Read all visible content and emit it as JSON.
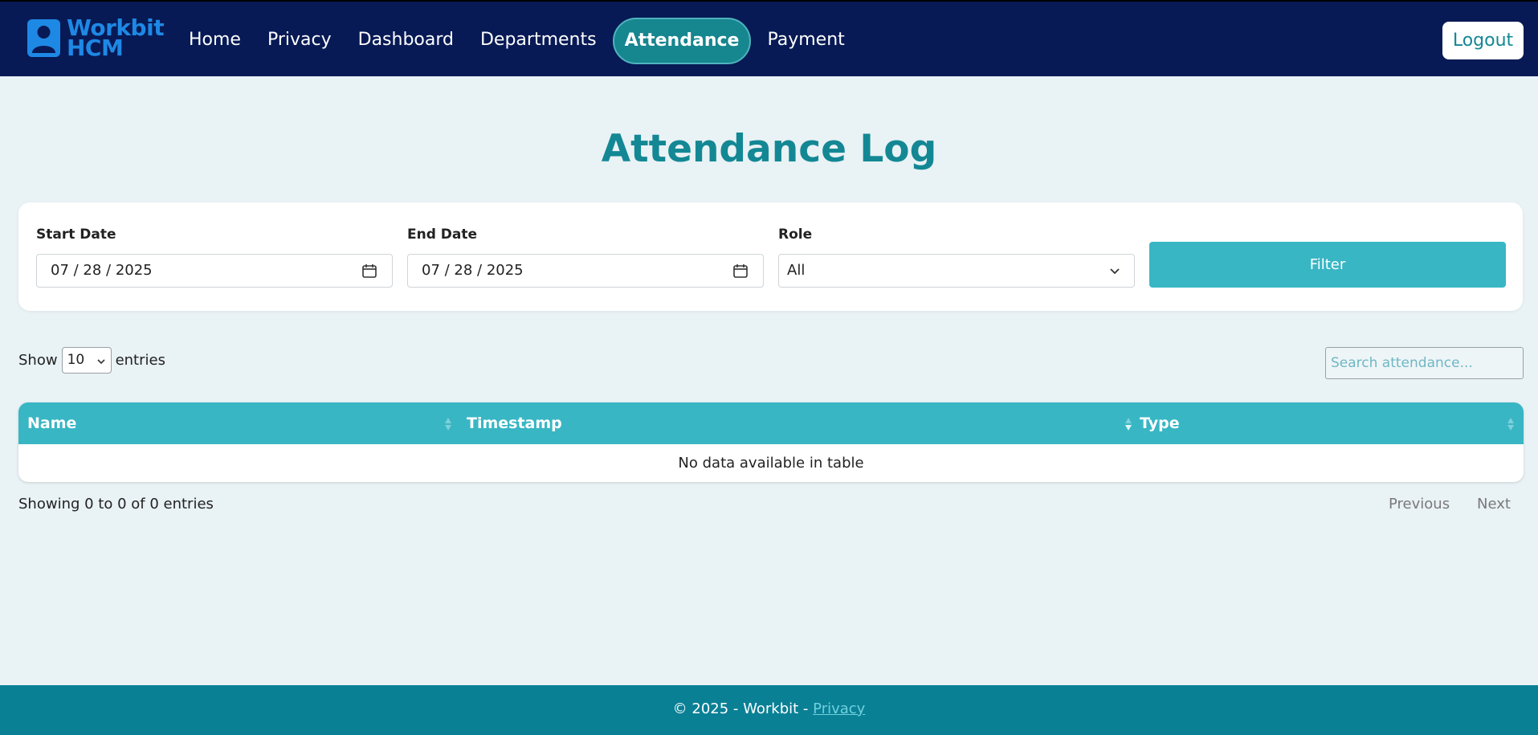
{
  "nav": {
    "brand_line1": "Workbit",
    "brand_line2": "HCM",
    "links": [
      "Home",
      "Privacy",
      "Dashboard",
      "Departments",
      "Attendance",
      "Payment"
    ],
    "active": "Attendance",
    "logout_label": "Logout"
  },
  "page": {
    "title": "Attendance Log"
  },
  "filters": {
    "start_label": "Start Date",
    "start_value": "07 / 28 / 2025",
    "end_label": "End Date",
    "end_value": "07 / 28 / 2025",
    "role_label": "Role",
    "role_value": "All",
    "filter_button": "Filter"
  },
  "table_controls": {
    "show_label": "Show",
    "entries_value": "10",
    "entries_label": "entries",
    "search_placeholder": "Search attendance..."
  },
  "table": {
    "columns": [
      "Name",
      "Timestamp",
      "Type"
    ],
    "empty_message": "No data available in table",
    "info": "Showing 0 to 0 of 0 entries",
    "previous": "Previous",
    "next": "Next"
  },
  "footer": {
    "text": "© 2025 - Workbit - ",
    "link": "Privacy"
  },
  "colors": {
    "navbar": "#071a55",
    "accent": "#38b6c4",
    "title": "#138894",
    "footer": "#0a8095",
    "brand": "#1e88e5"
  },
  "icons": [
    "user-icon",
    "calendar-icon",
    "chevron-down-icon",
    "sort-icon"
  ]
}
